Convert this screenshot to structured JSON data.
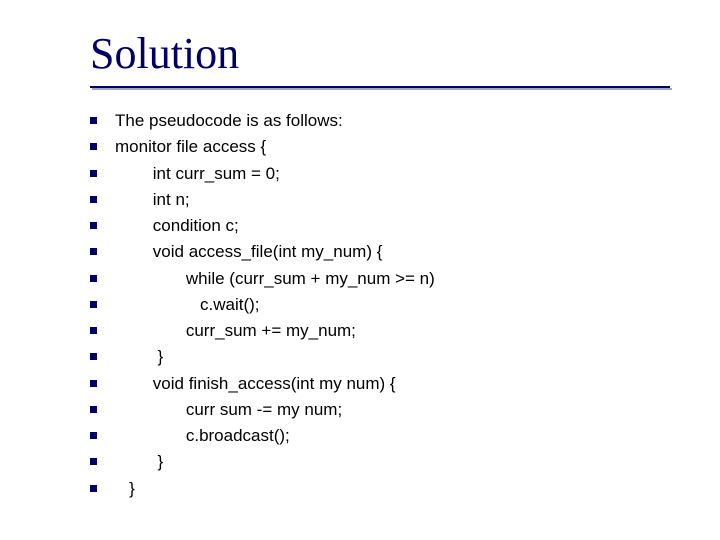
{
  "title": "Solution",
  "lines": [
    "The pseudocode is as follows:",
    "monitor file access {",
    "        int curr_sum = 0;",
    "        int n;",
    "        condition c;",
    "        void access_file(int my_num) {",
    "               while (curr_sum + my_num >= n)",
    "                  c.wait();",
    "               curr_sum += my_num;",
    "         }",
    "        void finish_access(int my num) {",
    "               curr sum -= my num;",
    "               c.broadcast();",
    "         }",
    "   }"
  ]
}
